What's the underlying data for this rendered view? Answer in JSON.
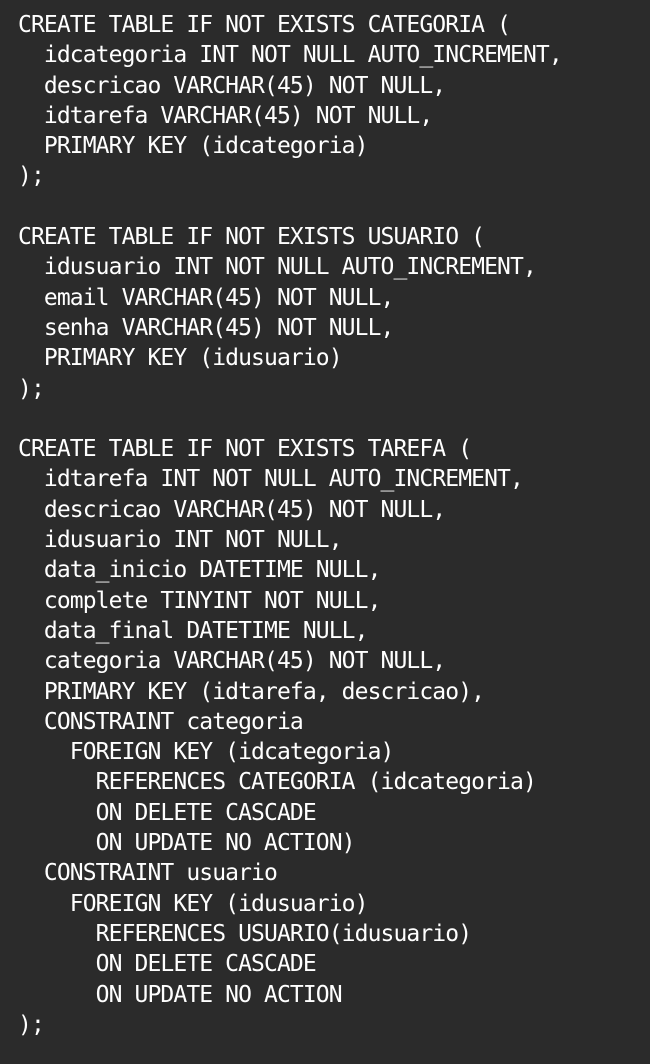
{
  "code": {
    "lines": [
      "CREATE TABLE IF NOT EXISTS CATEGORIA (",
      "  idcategoria INT NOT NULL AUTO_INCREMENT,",
      "  descricao VARCHAR(45) NOT NULL,",
      "  idtarefa VARCHAR(45) NOT NULL,",
      "  PRIMARY KEY (idcategoria)",
      ");",
      "",
      "CREATE TABLE IF NOT EXISTS USUARIO (",
      "  idusuario INT NOT NULL AUTO_INCREMENT,",
      "  email VARCHAR(45) NOT NULL,",
      "  senha VARCHAR(45) NOT NULL,",
      "  PRIMARY KEY (idusuario)",
      ");",
      "",
      "CREATE TABLE IF NOT EXISTS TAREFA (",
      "  idtarefa INT NOT NULL AUTO_INCREMENT,",
      "  descricao VARCHAR(45) NOT NULL,",
      "  idusuario INT NOT NULL,",
      "  data_inicio DATETIME NULL,",
      "  complete TINYINT NOT NULL,",
      "  data_final DATETIME NULL,",
      "  categoria VARCHAR(45) NOT NULL,",
      "  PRIMARY KEY (idtarefa, descricao),",
      "  CONSTRAINT categoria",
      "    FOREIGN KEY (idcategoria)",
      "      REFERENCES CATEGORIA (idcategoria)",
      "      ON DELETE CASCADE",
      "      ON UPDATE NO ACTION)",
      "  CONSTRAINT usuario",
      "    FOREIGN KEY (idusuario)",
      "      REFERENCES USUARIO(idusuario)",
      "      ON DELETE CASCADE",
      "      ON UPDATE NO ACTION",
      ");"
    ]
  }
}
